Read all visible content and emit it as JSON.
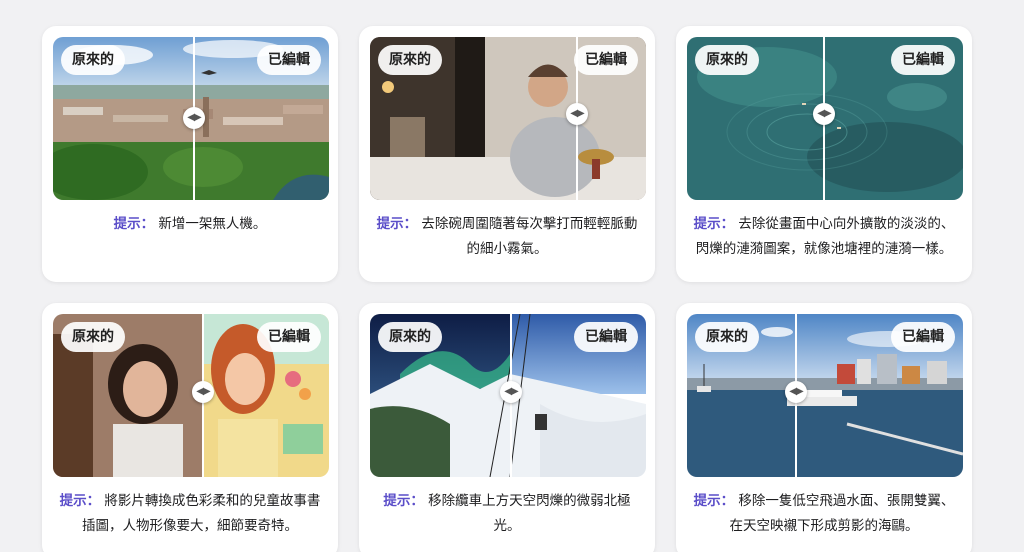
{
  "labels": {
    "original": "原來的",
    "edited": "已編輯"
  },
  "colors": {
    "accent": "#5b4ec9",
    "card_bg": "#ffffff",
    "page_bg": "#f1f1f3"
  },
  "cards": [
    {
      "prompt_label": "提示：",
      "prompt_text": "新增一架無人機。"
    },
    {
      "prompt_label": "提示：",
      "prompt_text": "去除碗周圍隨著每次擊打而輕輕脈動的細小霧氣。"
    },
    {
      "prompt_label": "提示：",
      "prompt_text": "去除從畫面中心向外擴散的淡淡的、閃爍的漣漪圖案，就像池塘裡的漣漪一樣。"
    },
    {
      "prompt_label": "提示：",
      "prompt_text": "將影片轉換成色彩柔和的兒童故事書插圖，人物形像要大，細節要奇特。"
    },
    {
      "prompt_label": "提示：",
      "prompt_text": "移除纜車上方天空閃爍的微弱北極光。"
    },
    {
      "prompt_label": "提示：",
      "prompt_text": "移除一隻低空飛過水面、張開雙翼、在天空映襯下形成剪影的海鷗。"
    }
  ],
  "icons": {
    "handle": "compare-slider-handle-icon"
  }
}
